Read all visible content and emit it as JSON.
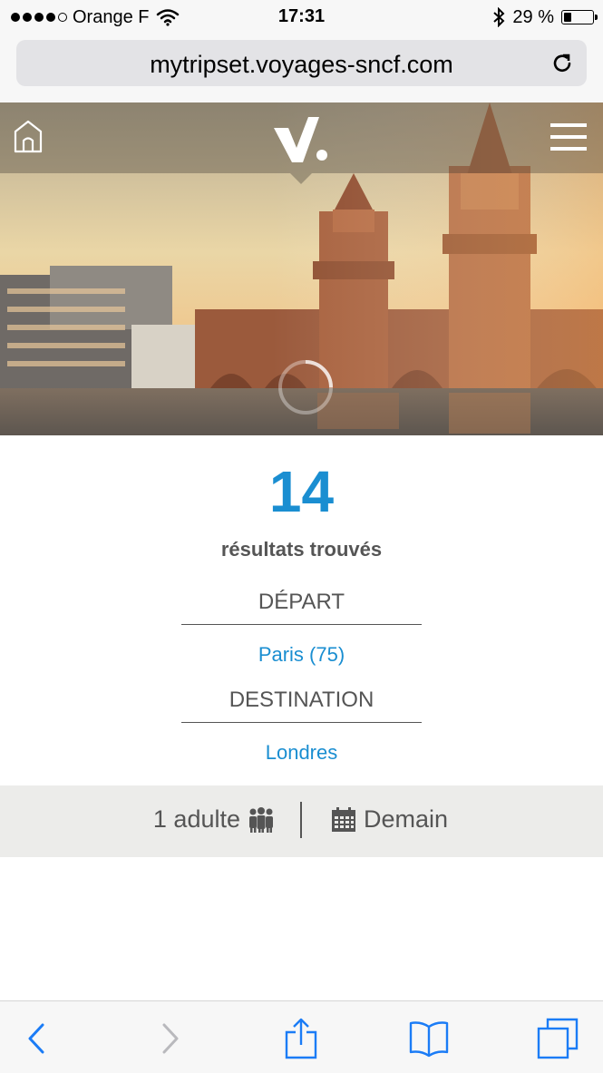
{
  "status_bar": {
    "carrier": "Orange F",
    "time": "17:31",
    "battery_text": "29 %",
    "battery_level": 0.29,
    "signal_bars": 4,
    "icons": [
      "wifi-icon",
      "bluetooth-icon",
      "battery-icon"
    ]
  },
  "browser": {
    "url": "mytripset.voyages-sncf.com"
  },
  "header": {
    "icons": [
      "home-icon",
      "voyages-logo",
      "hamburger-menu-icon",
      "loading-spinner-icon"
    ]
  },
  "results": {
    "count": "14",
    "count_label": "résultats trouvés",
    "departure_label": "DÉPART",
    "departure_value": "Paris (75)",
    "destination_label": "DESTINATION",
    "destination_value": "Londres"
  },
  "trip_info": {
    "passengers": "1 adulte",
    "date": "Demain",
    "icons": [
      "people-icon",
      "calendar-icon"
    ]
  },
  "toolbar": {
    "icons": [
      "back-icon",
      "forward-icon",
      "share-icon",
      "bookmarks-icon",
      "tabs-icon"
    ]
  },
  "colors": {
    "accent": "#1a8ed1",
    "text": "#555555",
    "info_bar_bg": "#ececea",
    "ios_blue": "#1b7cf6"
  }
}
